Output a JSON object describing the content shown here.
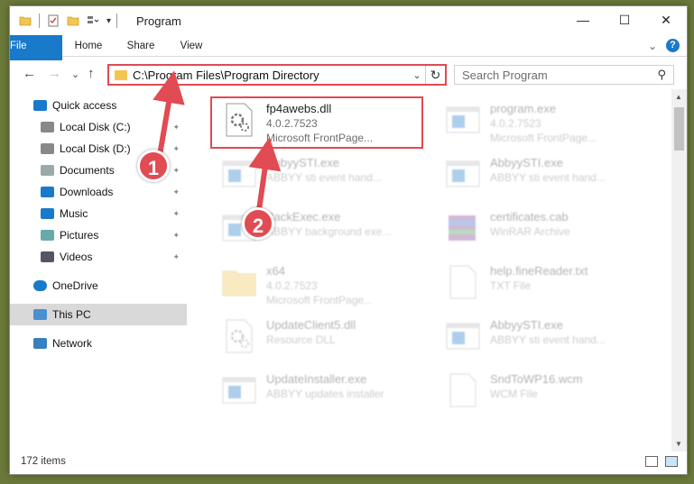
{
  "window": {
    "title": "Program",
    "minimize_glyph": "—",
    "maximize_glyph": "☐",
    "close_glyph": "✕"
  },
  "ribbon": {
    "tabs": [
      "File",
      "Home",
      "Share",
      "View"
    ],
    "expand_glyph": "⌄",
    "help_glyph": "?"
  },
  "nav": {
    "back_glyph": "←",
    "forward_glyph": "→",
    "recent_glyph": "⌄",
    "up_glyph": "↑"
  },
  "address": {
    "path": "C:\\Program Files\\Program Directory",
    "chevron_glyph": "⌄",
    "refresh_glyph": "↻"
  },
  "search": {
    "placeholder": "Search Program",
    "icon_glyph": "⚲"
  },
  "sidebar": {
    "items": [
      {
        "label": "Quick access",
        "icon": "star-icon",
        "pinned": false
      },
      {
        "label": "Local Disk (C:)",
        "icon": "drive-icon",
        "pinned": true
      },
      {
        "label": "Local Disk (D:)",
        "icon": "drive-icon",
        "pinned": true
      },
      {
        "label": "Documents",
        "icon": "documents-icon",
        "pinned": true
      },
      {
        "label": "Downloads",
        "icon": "download-icon",
        "pinned": true
      },
      {
        "label": "Music",
        "icon": "music-icon",
        "pinned": true
      },
      {
        "label": "Pictures",
        "icon": "pictures-icon",
        "pinned": true
      },
      {
        "label": "Videos",
        "icon": "videos-icon",
        "pinned": true
      },
      {
        "label": "OneDrive",
        "icon": "cloud-icon",
        "pinned": false
      },
      {
        "label": "This PC",
        "icon": "computer-icon",
        "pinned": false
      },
      {
        "label": "Network",
        "icon": "network-icon",
        "pinned": false
      }
    ],
    "pin_glyph": "📌"
  },
  "files": [
    {
      "name": "fp4awebs.dll",
      "line2": "4.0.2.7523",
      "line3": "Microsoft FrontPage...",
      "icon": "dll-gear-icon",
      "highlight": true
    },
    {
      "name": "program.exe",
      "line2": "4.0.2.7523",
      "line3": "Microsoft FrontPage...",
      "icon": "exe-icon"
    },
    {
      "name": "AbbyySTI.exe",
      "line2": "ABBYY sti event hand...",
      "line3": "",
      "icon": "exe-icon"
    },
    {
      "name": "AbbyySTI.exe",
      "line2": "ABBYY sti event hand...",
      "line3": "",
      "icon": "exe-icon"
    },
    {
      "name": "BackExec.exe",
      "line2": "ABBYY background exe...",
      "line3": "",
      "icon": "exe-icon"
    },
    {
      "name": "certificates.cab",
      "line2": "WinRAR Archive",
      "line3": "",
      "icon": "archive-icon"
    },
    {
      "name": "x64",
      "line2": "4.0.2.7523",
      "line3": "Microsoft FrontPage...",
      "icon": "folder-icon"
    },
    {
      "name": "help.fineReader.txt",
      "line2": "TXT File",
      "line3": "",
      "icon": "text-file-icon"
    },
    {
      "name": "UpdateClient5.dll",
      "line2": "Resource DLL",
      "line3": "",
      "icon": "dll-gear-icon"
    },
    {
      "name": "AbbyySTI.exe",
      "line2": "ABBYY sti event hand...",
      "line3": "",
      "icon": "exe-icon"
    },
    {
      "name": "UpdateInstaller.exe",
      "line2": "ABBYY updates installer",
      "line3": "",
      "icon": "exe-icon"
    },
    {
      "name": "SndToWP16.wcm",
      "line2": "WCM File",
      "line3": "",
      "icon": "text-file-icon"
    }
  ],
  "status": {
    "item_count": "172 items"
  },
  "callouts": [
    "1",
    "2"
  ],
  "colors": {
    "accent": "#1979ca",
    "highlight_red": "#e04a52",
    "folder_yellow": "#f3c553"
  }
}
